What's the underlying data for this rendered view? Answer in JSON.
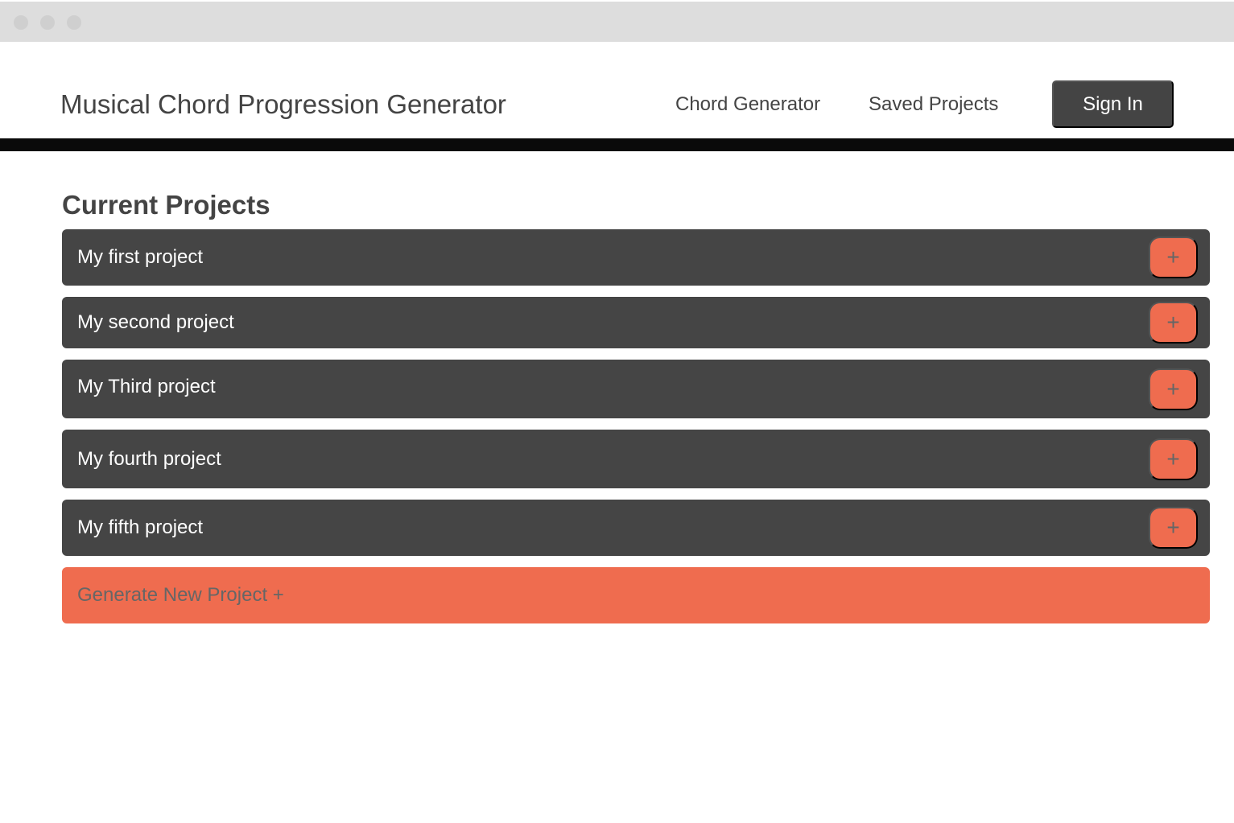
{
  "header": {
    "site_title": "Musical Chord Progression Generator",
    "nav": [
      {
        "label": "Chord Generator"
      },
      {
        "label": "Saved Projects"
      }
    ],
    "sign_in_label": "Sign In"
  },
  "main": {
    "section_heading": "Current Projects",
    "projects": [
      {
        "label": "My first project",
        "action_icon": "plus-icon",
        "action_glyph": "+"
      },
      {
        "label": "My second project",
        "action_icon": "plus-icon",
        "action_glyph": "+"
      },
      {
        "label": "My Third project",
        "action_icon": "plus-icon",
        "action_glyph": "+"
      },
      {
        "label": "My fourth project",
        "action_icon": "plus-icon",
        "action_glyph": "+"
      },
      {
        "label": "My fifth project",
        "action_icon": "plus-icon",
        "action_glyph": "+"
      }
    ],
    "generate_label": "Generate New Project +"
  },
  "colors": {
    "accent": "#ef6c4f",
    "row_background": "#454545",
    "header_rule": "#0a0a0a",
    "text_dark": "#444444"
  }
}
